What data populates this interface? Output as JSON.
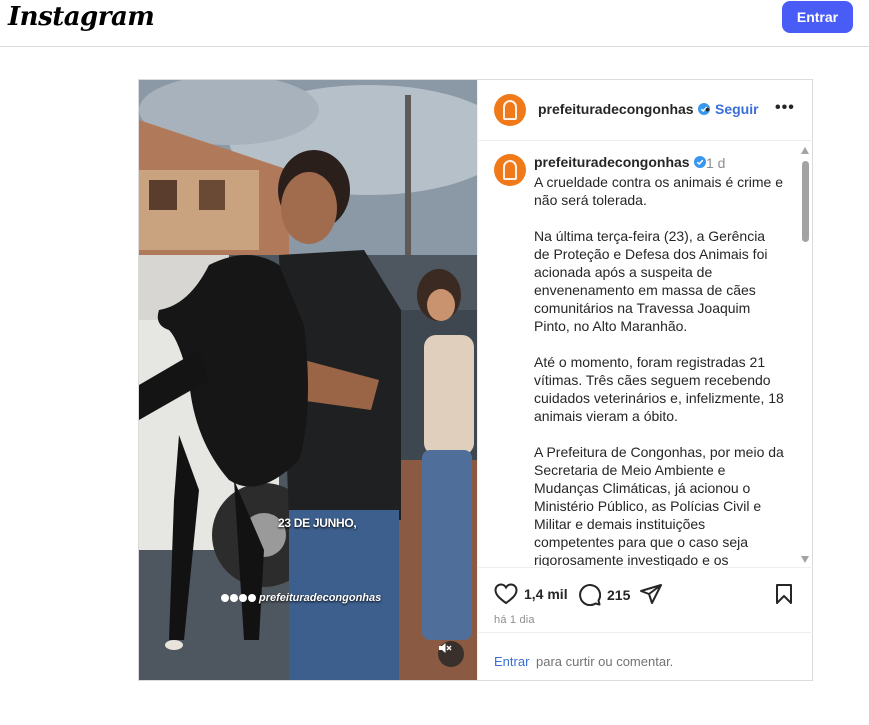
{
  "topbar": {
    "logo": "Instagram",
    "login_label": "Entrar"
  },
  "post": {
    "media": {
      "caption_overlay": "23 DE JUNHO,",
      "handle_overlay": "prefeituradecongonhas",
      "mute_icon": "speaker-muted-icon"
    },
    "header": {
      "username": "prefeituradecongonhas",
      "separator": "•",
      "follow_label": "Seguir",
      "more_label": "•••"
    },
    "caption": {
      "username": "prefeituradecongonhas",
      "time": "1 d",
      "paragraphs": [
        "A crueldade contra os animais é crime e não será tolerada.",
        "Na última terça-feira (23), a Gerência de Proteção e Defesa dos Animais foi acionada após a suspeita de envenenamento em massa de cães comunitários na Travessa Joaquim Pinto, no Alto Maranhão.",
        "Até o momento, foram registradas 21 vítimas. Três cães seguem recebendo cuidados veterinários e, infelizmente, 18 animais vieram a óbito.",
        "A Prefeitura de Congonhas, por meio da Secretaria de Meio Ambiente e Mudanças Climáticas, já acionou o Ministério Público, as Polícias Civil e Militar e demais instituições competentes para que o caso seja rigorosamente investigado e os"
      ]
    },
    "actions": {
      "likes": "1,4 mil",
      "comments": "215",
      "date": "há 1 dia"
    },
    "login_prompt": {
      "link": "Entrar",
      "rest": "para curtir ou comentar."
    }
  },
  "colors": {
    "accent": "#4a5cf6",
    "link": "#3a6fd8",
    "avatar": "#f07a1a"
  }
}
